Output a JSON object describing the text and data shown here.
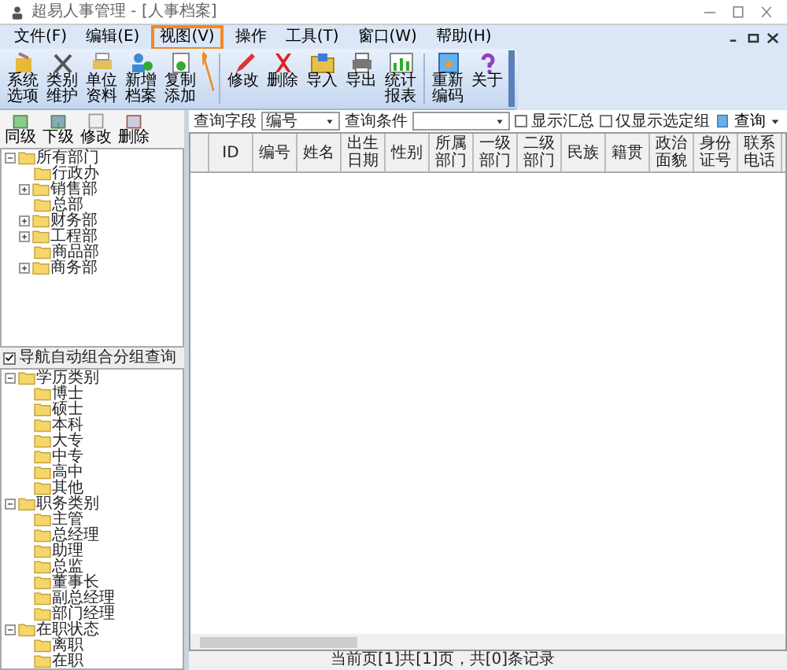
{
  "window": {
    "title": "超易人事管理 - [人事档案]"
  },
  "menu": [
    {
      "label": "文件(F)",
      "highlighted": false
    },
    {
      "label": "编辑(E)",
      "highlighted": false
    },
    {
      "label": "视图(V)",
      "highlighted": true
    },
    {
      "label": "操作",
      "highlighted": false
    },
    {
      "label": "工具(T)",
      "highlighted": false
    },
    {
      "label": "窗口(W)",
      "highlighted": false
    },
    {
      "label": "帮助(H)",
      "highlighted": false
    }
  ],
  "toolbar": {
    "groups": [
      [
        "系统选项",
        "类别维护",
        "单位资料",
        "新增档案",
        "复制添加"
      ],
      [
        "修改",
        "删除",
        "导入",
        "导出",
        "统计报表"
      ],
      [
        "重新编码",
        "关于"
      ]
    ]
  },
  "department_tools": [
    "同级",
    "下级",
    "修改",
    "删除"
  ],
  "department_tree": [
    {
      "label": "所有部门",
      "expanded": true,
      "children": [
        {
          "label": "行政办"
        },
        {
          "label": "销售部",
          "expanded": false
        },
        {
          "label": "总部"
        },
        {
          "label": "财务部",
          "expanded": false
        },
        {
          "label": "工程部",
          "expanded": false
        },
        {
          "label": "商品部"
        },
        {
          "label": "商务部",
          "expanded": false
        }
      ]
    }
  ],
  "auto_group": {
    "label": "导航自动组合分组查询",
    "checked": true
  },
  "group_tree": [
    {
      "label": "学历类别",
      "expanded": true,
      "children": [
        {
          "label": "博士"
        },
        {
          "label": "硕士"
        },
        {
          "label": "本科"
        },
        {
          "label": "大专"
        },
        {
          "label": "中专"
        },
        {
          "label": "高中"
        },
        {
          "label": "其他"
        }
      ]
    },
    {
      "label": "职务类别",
      "expanded": true,
      "children": [
        {
          "label": "主管"
        },
        {
          "label": "总经理"
        },
        {
          "label": "助理"
        },
        {
          "label": "总监"
        },
        {
          "label": "董事长"
        },
        {
          "label": "副总经理"
        },
        {
          "label": "部门经理"
        }
      ]
    },
    {
      "label": "在职状态",
      "expanded": true,
      "children": [
        {
          "label": "离职"
        },
        {
          "label": "在职"
        }
      ]
    }
  ],
  "query": {
    "field_label": "查询字段",
    "field_value": "编号",
    "condition_label": "查询条件",
    "show_summary": {
      "label": "显示汇总",
      "checked": false
    },
    "selected_only": {
      "label": "仅显示选定组",
      "checked": false
    },
    "search_button": "查询"
  },
  "table": {
    "columns": [
      "ID",
      "编号",
      "姓名",
      "出生日期",
      "性别",
      "所属部门",
      "一级部门",
      "二级部门",
      "民族",
      "籍贯",
      "政治面貌",
      "身份证号",
      "联系电话"
    ]
  },
  "status_bar": "当前页[1]共[1]页，共[0]条记录"
}
